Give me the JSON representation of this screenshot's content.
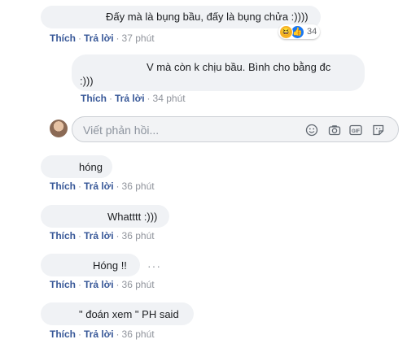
{
  "comments": [
    {
      "text": "Đấy mà là bụng bầu, đấy là bụng chửa :))))",
      "time": "37 phút",
      "reactions": {
        "count": "34",
        "icons": [
          "haha-icon",
          "like-icon"
        ]
      }
    },
    {
      "text": "V mà còn k chịu bầu. Bình cho bằng đc",
      "text2": ":)))",
      "time": "34 phút"
    },
    {
      "text": "hóng",
      "time": "36 phút"
    },
    {
      "text": "Whatttt :)))",
      "time": "36 phút"
    },
    {
      "text": "Hóng !!",
      "time": "36 phút"
    },
    {
      "text": "\" đoán xem \" PH said",
      "time": "36 phút"
    }
  ],
  "actions": {
    "like": "Thích",
    "reply": "Trả lời",
    "sep": "·"
  },
  "reply_box": {
    "placeholder": "Viết phản hồi...",
    "tools": [
      "emoji-icon",
      "camera-icon",
      "gif-icon",
      "sticker-icon"
    ]
  },
  "colors": {
    "bubble": "#f0f2f5",
    "link": "#385898",
    "muted": "#90949c"
  }
}
